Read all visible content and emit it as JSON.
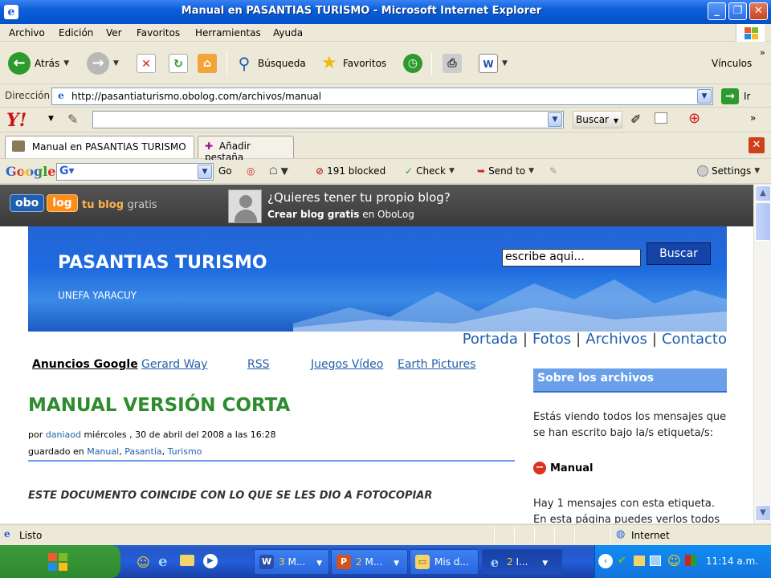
{
  "window": {
    "title": "Manual en PASANTIAS TURISMO - Microsoft Internet Explorer"
  },
  "menu": {
    "items": [
      "Archivo",
      "Edición",
      "Ver",
      "Favoritos",
      "Herramientas",
      "Ayuda"
    ]
  },
  "toolbar": {
    "back": "Atrás",
    "search": "Búsqueda",
    "favorites": "Favoritos",
    "links": "Vínculos"
  },
  "address": {
    "label": "Dirección",
    "url": "http://pasantiaturismo.obolog.com/archivos/manual",
    "go": "Ir"
  },
  "yahoo": {
    "search_value": "",
    "search_button": "Buscar"
  },
  "tabs": {
    "active": "Manual en PASANTIAS TURISMO",
    "add": "Añadir pestaña"
  },
  "google": {
    "logo": "Google",
    "search_value": "",
    "go": "Go",
    "blocked": "191 blocked",
    "check": "Check",
    "send_to": "Send to",
    "settings": "Settings"
  },
  "obolog": {
    "logo_left": "obo",
    "logo_right": "log",
    "tagline": "tu blog",
    "tagline_suffix": "gratis",
    "promo_title": "¿Quieres tener tu propio blog?",
    "promo_link": "Crear blog gratis",
    "promo_suffix": "en OboLog"
  },
  "blog": {
    "title": "PASANTIAS TURISMO",
    "subtitle": "UNEFA YARACUY",
    "search_value": "escribe aqui...",
    "search_button": "Buscar"
  },
  "nav": {
    "items": [
      "Portada",
      "Fotos",
      "Archivos",
      "Contacto"
    ]
  },
  "ads": {
    "label": "Anuncios Google",
    "links": [
      "Gerard Way",
      "RSS",
      "Juegos Vídeo",
      "Earth Pictures"
    ]
  },
  "post": {
    "title": "MANUAL VERSIÓN CORTA",
    "by": "por",
    "author": "daniaod",
    "date": "miércoles , 30 de abril del 2008 a las 16:28",
    "filed": "guardado en",
    "tags": [
      "Manual",
      "Pasantía",
      "Turismo"
    ],
    "body": "ESTE DOCUMENTO COINCIDE CON LO QUE SE LES DIO A FOTOCOPIAR"
  },
  "sidebar": {
    "heading": "Sobre los archivos",
    "intro": "Estás viendo todos los mensajes que se han escrito bajo la/s etiqueta/s:",
    "tag": "Manual",
    "count_text": "Hay 1 mensajes con esta etiqueta.",
    "cut_text": "En esta página puedes verlos todos"
  },
  "status": {
    "text": "Listo",
    "zone": "Internet"
  },
  "taskbar": {
    "tasks": [
      {
        "num": "3",
        "label": "M..."
      },
      {
        "num": "2",
        "label": "M..."
      },
      {
        "num": "",
        "label": "Mis d..."
      },
      {
        "num": "2",
        "label": "I..."
      }
    ],
    "clock": "11:14 a.m."
  },
  "colors": {
    "xp_blue": "#0551c9",
    "link_blue": "#1f5fad",
    "post_title_green": "#2e8b2e",
    "banner_blue": "#1e6be0"
  }
}
